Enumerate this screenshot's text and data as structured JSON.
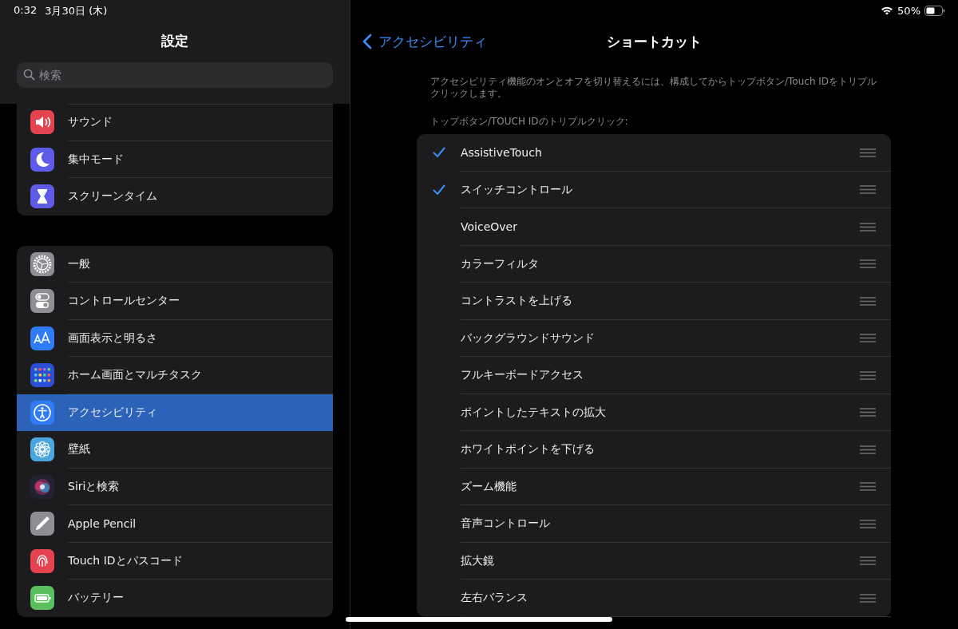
{
  "status_bar": {
    "time": "0:32",
    "date": "3月30日 (木)",
    "battery": "50%"
  },
  "sidebar": {
    "title": "設定",
    "search": {
      "placeholder": "検索"
    },
    "groups": [
      [
        {
          "label": "サウンド",
          "kind": "sound",
          "color": "#e5434f",
          "selected": false
        },
        {
          "label": "集中モード",
          "kind": "moon",
          "color": "#5e5ce6",
          "selected": false
        },
        {
          "label": "スクリーンタイム",
          "kind": "hourglass",
          "color": "#5e5ce6",
          "selected": false
        }
      ],
      [
        {
          "label": "一般",
          "kind": "gear",
          "color": "#8e8e93",
          "selected": false
        },
        {
          "label": "コントロールセンター",
          "kind": "toggles",
          "color": "#8e8e93",
          "selected": false
        },
        {
          "label": "画面表示と明るさ",
          "kind": "text",
          "color": "#2f7cf6",
          "selected": false
        },
        {
          "label": "ホーム画面とマルチタスク",
          "kind": "grid",
          "color": "#2a4fd6",
          "selected": false
        },
        {
          "label": "アクセシビリティ",
          "kind": "accessibility",
          "color": "#2f7cf6",
          "selected": true
        },
        {
          "label": "壁紙",
          "kind": "flower",
          "color": "#4aa6dc",
          "selected": false
        },
        {
          "label": "Siriと検索",
          "kind": "siri",
          "color": "#222233",
          "selected": false
        },
        {
          "label": "Apple Pencil",
          "kind": "pencil",
          "color": "#8e8e93",
          "selected": false
        },
        {
          "label": "Touch IDとパスコード",
          "kind": "fingerprint",
          "color": "#e5434f",
          "selected": false
        },
        {
          "label": "バッテリー",
          "kind": "battery",
          "color": "#5ac05f",
          "selected": false
        }
      ]
    ]
  },
  "detail": {
    "back": "アクセシビリティ",
    "title": "ショートカット",
    "description": "アクセシビリティ機能のオンとオフを切り替えるには、構成してからトップボタン/Touch IDをトリプルクリックします。",
    "section_header": "トップボタン/TOUCH IDのトリプルクリック:",
    "items": [
      {
        "label": "AssistiveTouch",
        "checked": true
      },
      {
        "label": "スイッチコントロール",
        "checked": true
      },
      {
        "label": "VoiceOver",
        "checked": false
      },
      {
        "label": "カラーフィルタ",
        "checked": false
      },
      {
        "label": "コントラストを上げる",
        "checked": false
      },
      {
        "label": "バックグラウンドサウンド",
        "checked": false
      },
      {
        "label": "フルキーボードアクセス",
        "checked": false
      },
      {
        "label": "ポイントしたテキストの拡大",
        "checked": false
      },
      {
        "label": "ホワイトポイントを下げる",
        "checked": false
      },
      {
        "label": "ズーム機能",
        "checked": false
      },
      {
        "label": "音声コントロール",
        "checked": false
      },
      {
        "label": "拡大鏡",
        "checked": false
      },
      {
        "label": "左右バランス",
        "checked": false
      }
    ]
  }
}
